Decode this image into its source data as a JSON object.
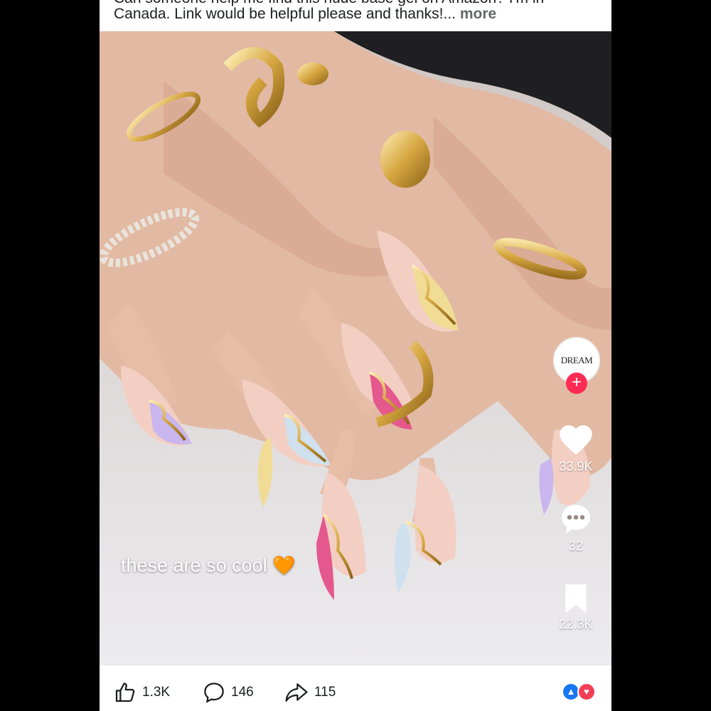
{
  "post": {
    "caption_cut": "Can someone help me find this nude base gel on Amazon? I'm in",
    "caption_line": "Canada. Link would be helpful please and thanks!...",
    "more_label": "more"
  },
  "video": {
    "overlay_text": "these are so cool",
    "overlay_emoji": "🧡",
    "creator_avatar_text": "DREAM",
    "follow_symbol": "+",
    "likes": "33.9K",
    "comments": "32",
    "saves": "22.3K"
  },
  "actions": {
    "likes": "1.3K",
    "comments": "146",
    "shares": "115"
  },
  "icons": {
    "like": "thumbs-up-icon",
    "comment": "comment-bubble-icon",
    "share": "share-arrow-icon",
    "reaction_like": "like-reaction-icon",
    "reaction_love": "love-reaction-icon",
    "tiktok_heart": "heart-icon",
    "tiktok_comment": "comment-dots-icon",
    "tiktok_save": "bookmark-icon"
  },
  "colors": {
    "follow": "#fe2c55",
    "like_reaction": "#1877f2",
    "love_reaction": "#f33e58",
    "overlay_heart": "#ff9a1f"
  }
}
